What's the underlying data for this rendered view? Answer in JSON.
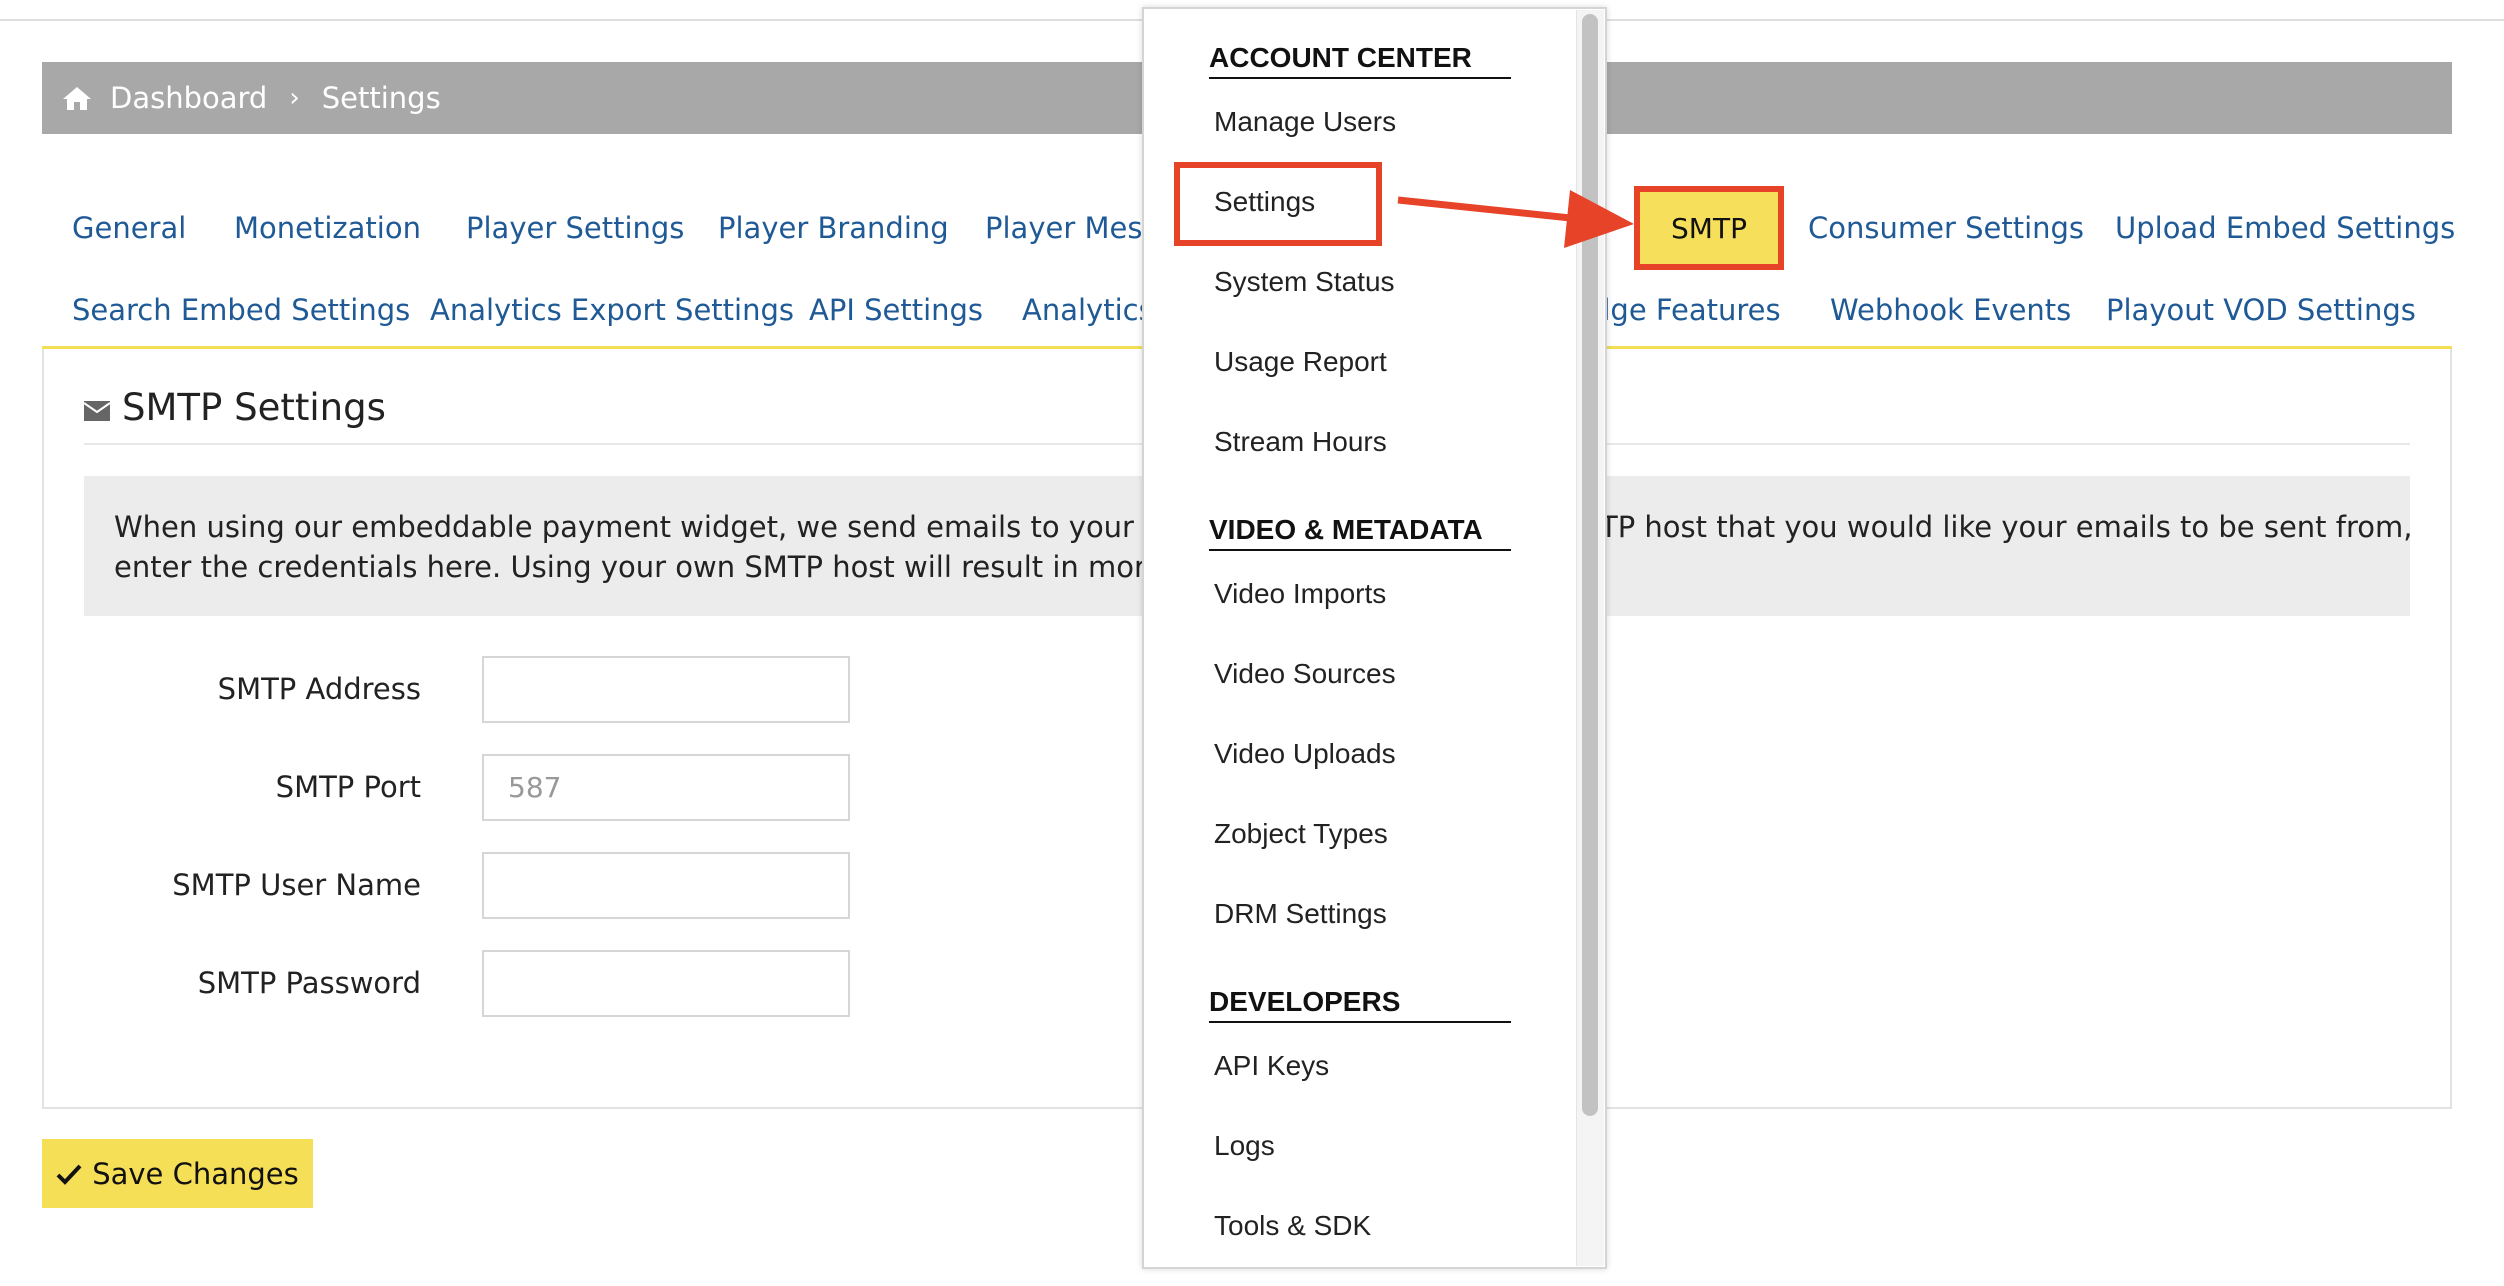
{
  "breadcrumb": {
    "home_label": "Dashboard",
    "separator": "›",
    "current": "Settings"
  },
  "tabs_row1": [
    "General",
    "Monetization",
    "Player Settings",
    "Player Branding",
    "Player Mess",
    "SMTP",
    "Consumer Settings",
    "Upload Embed Settings"
  ],
  "tabs_row2": [
    "Search Embed Settings",
    "Analytics Export Settings",
    "API Settings",
    "Analytics",
    "dge Features",
    "Webhook Events",
    "Playout VOD Settings"
  ],
  "panel": {
    "title": "SMTP Settings",
    "info_line1_left": "When using our embeddable payment widget, we send emails to your custome",
    "info_line1_right": "TP host that you would like your emails to be sent from,",
    "info_line2_left": "enter the credentials here. Using your own SMTP host will result in more reliabl"
  },
  "form": {
    "address_label": "SMTP Address",
    "address_value": "",
    "port_label": "SMTP Port",
    "port_placeholder": "587",
    "username_label": "SMTP User Name",
    "username_value": "",
    "password_label": "SMTP Password",
    "password_value": ""
  },
  "save_button_label": "Save Changes",
  "dropdown": {
    "section1_header": "ACCOUNT CENTER",
    "section1_items": [
      "Manage Users",
      "Settings",
      "System Status",
      "Usage Report",
      "Stream Hours"
    ],
    "section2_header": "VIDEO & METADATA",
    "section2_items": [
      "Video Imports",
      "Video Sources",
      "Video Uploads",
      "Zobject Types",
      "DRM Settings"
    ],
    "section3_header": "DEVELOPERS",
    "section3_items": [
      "API Keys",
      "Logs",
      "Tools & SDK"
    ]
  },
  "colors": {
    "accent_yellow": "#f4df56",
    "link_blue": "#1f5a96",
    "annotation_red": "#e64328",
    "breadcrumb_gray": "#a8a8a8"
  }
}
